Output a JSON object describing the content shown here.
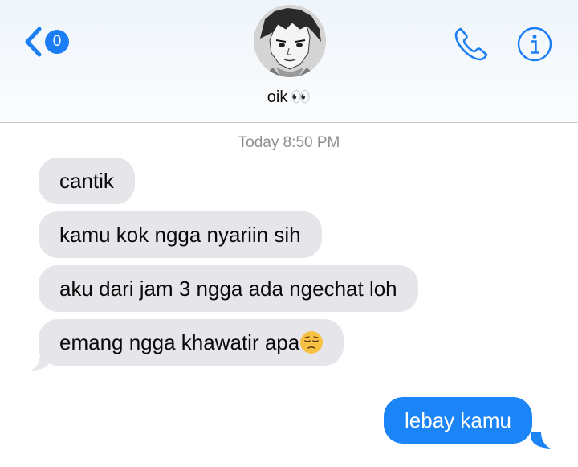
{
  "header": {
    "unread_count": "0",
    "contact_name": "oik",
    "contact_emoji": "👀",
    "icons": {
      "back": "chevron-left-icon",
      "call": "phone-icon",
      "info": "info-icon"
    },
    "accent_color": "#1b7ef5"
  },
  "conversation": {
    "timestamp": "Today 8:50 PM",
    "incoming": [
      "cantik",
      "kamu kok ngga nyariin sih",
      "aku dari jam 3 ngga ada ngechat loh",
      "emang ngga khawatir apa"
    ],
    "incoming_last_emoji": "pensive-face",
    "outgoing": [
      "lebay kamu"
    ]
  },
  "colors": {
    "incoming_bubble": "#e5e5ea",
    "outgoing_bubble": "#1b84f7"
  }
}
